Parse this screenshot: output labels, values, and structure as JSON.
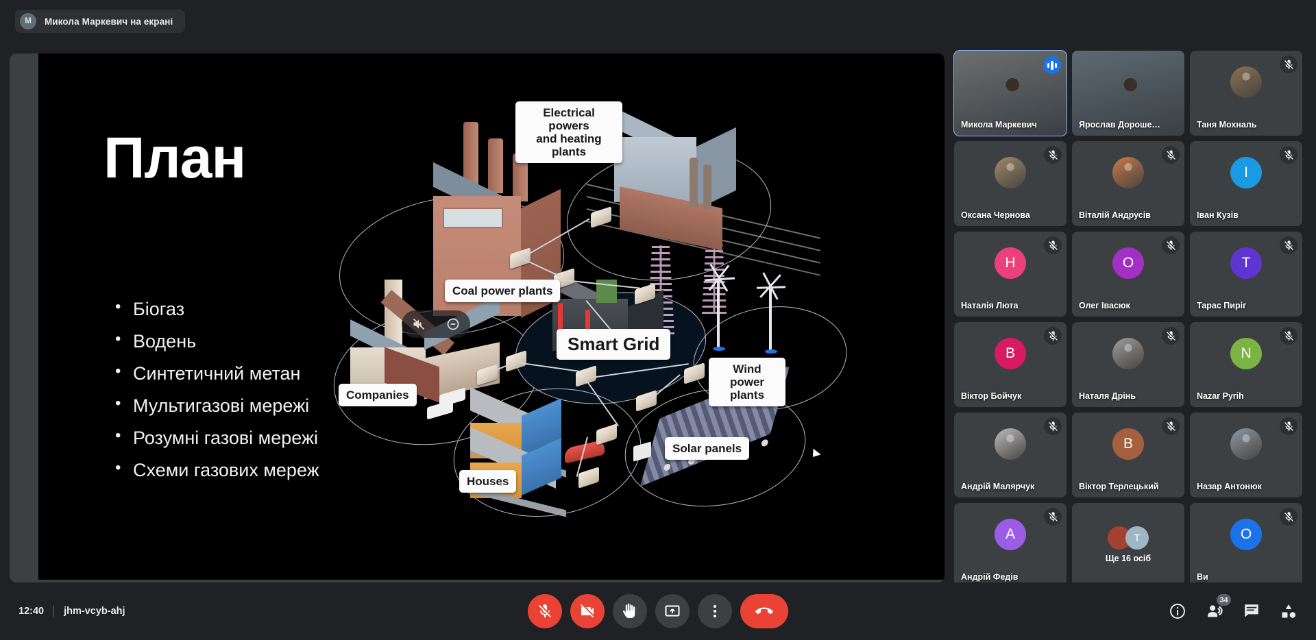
{
  "header": {
    "presenter_initial": "M",
    "presenting_text": "Микола Маркевич на екрані"
  },
  "slide": {
    "title": "План",
    "bullets": [
      "Біогаз",
      "Водень",
      "Синтетичний метан",
      "Мультигазові мережі",
      "Розумні газові мережі",
      "Схеми газових мереж"
    ],
    "diagram_labels": {
      "electrical": "Electrical powers\nand heating plants",
      "coal": "Coal power plants",
      "companies": "Companies",
      "smart_grid": "Smart Grid",
      "wind": "Wind power\nplants",
      "solar": "Solar panels",
      "houses": "Houses"
    }
  },
  "filmstrip": {
    "tiles": [
      {
        "name": "Микола Маркевич",
        "kind": "video",
        "active": true,
        "speaking": true,
        "muted": false,
        "video_tone": "#6c6f6e"
      },
      {
        "name": "Ярослав Дороше…",
        "kind": "video",
        "active": false,
        "speaking": false,
        "muted": false,
        "video_tone": "#5d6a72"
      },
      {
        "name": "Таня Мохналь",
        "kind": "photo",
        "active": false,
        "speaking": false,
        "muted": true,
        "avatar_color": "#8a7254"
      },
      {
        "name": "Оксана Чернова",
        "kind": "photo",
        "active": false,
        "speaking": false,
        "muted": true,
        "avatar_color": "#a08a6a"
      },
      {
        "name": "Віталій Андрусів",
        "kind": "photo",
        "active": false,
        "speaking": false,
        "muted": true,
        "avatar_color": "#c97a4a"
      },
      {
        "name": "Іван Кузів",
        "kind": "initial",
        "initial": "І",
        "active": false,
        "speaking": false,
        "muted": true,
        "avatar_color": "#1a9ae2"
      },
      {
        "name": "Наталія Люта",
        "kind": "initial",
        "initial": "Н",
        "active": false,
        "speaking": false,
        "muted": true,
        "avatar_color": "#ec407a"
      },
      {
        "name": "Олег Івасюк",
        "kind": "initial",
        "initial": "О",
        "active": false,
        "speaking": false,
        "muted": true,
        "avatar_color": "#a32fc4"
      },
      {
        "name": "Тарас Пиріг",
        "kind": "initial",
        "initial": "Т",
        "active": false,
        "speaking": false,
        "muted": true,
        "avatar_color": "#5e35d1"
      },
      {
        "name": "Віктор Бойчук",
        "kind": "initial",
        "initial": "В",
        "active": false,
        "speaking": false,
        "muted": true,
        "avatar_color": "#d81b60"
      },
      {
        "name": "Наталя Дрінь",
        "kind": "photo",
        "active": false,
        "speaking": false,
        "muted": true,
        "avatar_color": "#9e9e9e"
      },
      {
        "name": "Nazar Pyrih",
        "kind": "initial",
        "initial": "N",
        "active": false,
        "speaking": false,
        "muted": true,
        "avatar_color": "#7cb342"
      },
      {
        "name": "Андрій Малярчук",
        "kind": "photo",
        "active": false,
        "speaking": false,
        "muted": true,
        "avatar_color": "#bdbdbd"
      },
      {
        "name": "Віктор Терлецький",
        "kind": "initial",
        "initial": "В",
        "active": false,
        "speaking": false,
        "muted": true,
        "avatar_color": "#a5603f"
      },
      {
        "name": "Назар Антонюк",
        "kind": "photo",
        "active": false,
        "speaking": false,
        "muted": true,
        "avatar_color": "#8d9aa5"
      },
      {
        "name": "Андрій Федів",
        "kind": "initial",
        "initial": "А",
        "active": false,
        "speaking": false,
        "muted": true,
        "avatar_color": "#9b5de5"
      },
      {
        "name": "Ще 16 осіб",
        "kind": "more",
        "more_initial": "Т",
        "more_avatar_color": "#9fb6c4",
        "more_photo_color": "#a44232",
        "active": false,
        "speaking": false,
        "muted": false
      },
      {
        "name": "Ви",
        "kind": "initial",
        "initial": "О",
        "active": false,
        "speaking": false,
        "muted": true,
        "avatar_color": "#1a73e8"
      }
    ]
  },
  "bottombar": {
    "time": "12:40",
    "meeting_code": "jhm-vcyb-ahj",
    "controls": [
      {
        "name": "microphone",
        "label": "Вимкнути мікрофон",
        "state": "muted"
      },
      {
        "name": "camera",
        "label": "Вимкнути камеру",
        "state": "off"
      },
      {
        "name": "raise-hand",
        "label": "Підняти руку",
        "state": "normal"
      },
      {
        "name": "present",
        "label": "Демонстрація екрана",
        "state": "normal"
      },
      {
        "name": "more-options",
        "label": "Інші параметри",
        "state": "normal"
      },
      {
        "name": "leave-call",
        "label": "Вийти з дзвінка",
        "state": "danger"
      }
    ],
    "right_controls": [
      {
        "name": "meeting-details",
        "label": "Відомості про зустріч"
      },
      {
        "name": "participants",
        "label": "Учасники",
        "badge": "34"
      },
      {
        "name": "chat",
        "label": "Чат"
      },
      {
        "name": "activities",
        "label": "Заходи"
      }
    ],
    "participant_count": "34"
  },
  "colors": {
    "accent": "#8ab4f8",
    "danger": "#ea4335",
    "surface": "#3c4043",
    "background": "#202124"
  }
}
